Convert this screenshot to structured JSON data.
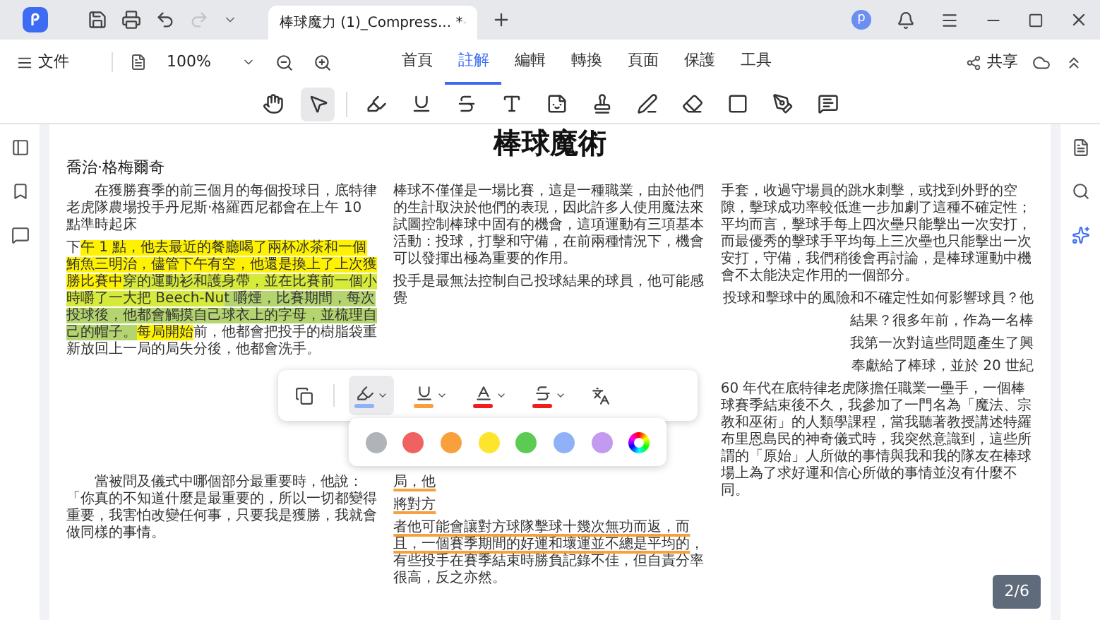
{
  "app": {
    "tab_title": "棒球魔力 (1)_Compress... *",
    "avatar": "p",
    "history": [
      {
        "kind": "undo",
        "disabled": false
      },
      {
        "kind": "redo",
        "disabled": true
      }
    ]
  },
  "menu": {
    "file": "文件",
    "zoom": "100%",
    "share": "共享",
    "tabs": [
      {
        "label": "首頁",
        "selected": false
      },
      {
        "label": "註解",
        "selected": true
      },
      {
        "label": "編輯",
        "selected": false
      },
      {
        "label": "轉換",
        "selected": false
      },
      {
        "label": "頁面",
        "selected": false
      },
      {
        "label": "保護",
        "selected": false
      },
      {
        "label": "工具",
        "selected": false
      }
    ]
  },
  "tools": [
    {
      "kind": "hand",
      "selected": false
    },
    {
      "kind": "select",
      "selected": true
    },
    {
      "kind": "highlight",
      "selected": false
    },
    {
      "kind": "underline",
      "selected": false
    },
    {
      "kind": "strikethrough",
      "selected": false
    },
    {
      "kind": "squiggly",
      "selected": false
    },
    {
      "kind": "shape",
      "selected": false
    },
    {
      "kind": "stamp",
      "selected": false
    },
    {
      "kind": "marker",
      "selected": false
    },
    {
      "kind": "eraser",
      "selected": false
    },
    {
      "kind": "rectangle",
      "selected": false
    },
    {
      "kind": "pen",
      "selected": false
    },
    {
      "kind": "comment",
      "selected": false
    }
  ],
  "document": {
    "title": "棒球魔術",
    "author": "喬治·格梅爾奇",
    "left_top": [
      {
        "kind": "paragraph",
        "indented": true,
        "segments": [
          {
            "kind": "plain",
            "text": "在獲勝賽季的前三個月的每個投球日，底特律老虎隊農場投手丹尼斯·格羅西尼都會在上午 10 點準時起床"
          }
        ]
      },
      {
        "kind": "paragraph",
        "indented": false,
        "segments": [
          {
            "kind": "plain",
            "text": "下"
          },
          {
            "kind": "highlight",
            "color": "#fff200",
            "text": "午 1 點，他去最近的餐廳喝了兩杯冰茶和一個鮪魚三明治，儘管下午有空，他還是換上了上次獲勝比賽中"
          },
          {
            "kind": "highlight",
            "color": "#d6ea3a",
            "text": "穿的運動衫和護身帶，並在比賽前一個小時嚼了一大把 Beech-Nu"
          },
          {
            "kind": "highlight",
            "color": "#b3d46e",
            "text": "t 嚼煙，比賽期間，每次投球後，他都會觸摸自己球衣上的字母，並梳理自己的帽子。"
          },
          {
            "kind": "highlight",
            "color": "#fff200",
            "text": "每局開始"
          },
          {
            "kind": "plain",
            "text": "前，他都會把投手的樹脂袋重新放回上一局的"
          },
          {
            "kind": "plain",
            "text": "局失分後，他都會洗手。"
          }
        ]
      }
    ],
    "middle_top": [
      {
        "kind": "paragraph",
        "indented": false,
        "segments": [
          {
            "kind": "plain",
            "text": "棒球不僅僅是一場比賽，這是一種職業，由於他們的生計取決於他們的表現，因此許多人使用魔法來試圖控制棒球中固有的機會，這項運動有三項基本活動：投球，打擊和守備，在前兩種情況下，機會可以發揮出極為重要的作用。"
          }
        ]
      },
      {
        "kind": "paragraph",
        "indented": false,
        "segments": [
          {
            "kind": "plain",
            "text": "投手是最無法控制自己投球結果的球員，他可能感覺"
          }
        ]
      }
    ],
    "right": [
      {
        "kind": "paragraph",
        "indented": false,
        "segments": [
          {
            "kind": "plain",
            "text": "手套，收過守場員的跳水刺擊，或找到外野的空隙，擊球成功率較低進一步加劇了這種不確定性；平均而言，擊球手每上四次壘只能擊出一次安打，而最優秀的擊球手平均每上三次壘也只能擊出一次安打，守備，我們稍後會再討論，是棒球運動中機會不太能決定作用的一個部分。"
          }
        ]
      },
      {
        "kind": "fragment",
        "segments": [
          {
            "kind": "plain",
            "text": "投球和擊球中的風險和不確定性如何影響球員？他"
          }
        ]
      },
      {
        "kind": "fragment",
        "segments": [
          {
            "kind": "plain",
            "text": "結果？很多年前，作為一名棒"
          }
        ]
      },
      {
        "kind": "fragment",
        "segments": [
          {
            "kind": "plain",
            "text": "我第一次對這些問題產生了興"
          }
        ]
      },
      {
        "kind": "fragment",
        "segments": [
          {
            "kind": "plain",
            "text": "奉獻給了棒球，並於 20 世紀"
          }
        ]
      },
      {
        "kind": "paragraph",
        "indented": false,
        "segments": [
          {
            "kind": "plain",
            "text": "60 年代在底特律老虎隊擔任職業一壘手，一個棒球賽季結束後不久，我參加了一門名為「魔法、宗教和巫術」的人類學課程，當我聽著教授講述特羅布里恩島民的神奇儀式時，我突然意識到，這些所謂的「原始」人所做的事情與我和我的隊友在棒球場上為了求好運和信心所做的事情並沒有什麼不同。"
          }
        ]
      }
    ],
    "left_bottom": [
      {
        "kind": "paragraph",
        "indented": true,
        "segments": [
          {
            "kind": "plain",
            "text": "當被問及儀式中哪個部分最重要時，他說：「你真的不知道什麼是最重要的，所以一切都變得重要，我害怕改變任何事，只要我是獲勝，我就會做同樣的事情。"
          }
        ]
      }
    ],
    "middle_bottom": [
      {
        "kind": "paragraph",
        "indented": false,
        "segments": [
          {
            "kind": "underline",
            "color": "#f7a03c",
            "text": "局，他"
          }
        ]
      },
      {
        "kind": "paragraph",
        "indented": false,
        "segments": [
          {
            "kind": "underline",
            "color": "#f7a03c",
            "text": "將對方"
          }
        ]
      },
      {
        "kind": "paragraph",
        "indented": false,
        "segments": [
          {
            "kind": "underline",
            "color": "#f7a03c",
            "text": "者他可能會讓對方球隊擊球十幾次無功而返，而且，一個賽季期間的好運和壞運並不總是平均的"
          },
          {
            "kind": "plain",
            "text": "，有些投手在賽季結束時勝負記錄不佳，但自責分率很高，反之亦然。"
          }
        ]
      }
    ]
  },
  "popup": {
    "tools": [
      {
        "kind": "copy",
        "selected": false
      },
      {
        "kind": "highlight",
        "selected": true,
        "color": "#8fb1f8"
      },
      {
        "kind": "underline",
        "selected": false,
        "color": "#f7a03c"
      },
      {
        "kind": "text-color",
        "selected": false,
        "color": "#f01d1d"
      },
      {
        "kind": "strikethrough",
        "selected": false,
        "color": "#f01d1d"
      },
      {
        "kind": "translate",
        "selected": false
      }
    ],
    "palette": [
      {
        "kind": "swatch",
        "color": "#b0b3b8"
      },
      {
        "kind": "swatch",
        "color": "#f06262"
      },
      {
        "kind": "swatch",
        "color": "#f7a03c"
      },
      {
        "kind": "swatch",
        "color": "#fde52c"
      },
      {
        "kind": "swatch",
        "color": "#5ccb54"
      },
      {
        "kind": "swatch",
        "color": "#8fb1f8"
      },
      {
        "kind": "swatch",
        "color": "#c29af0"
      },
      {
        "kind": "spectrum"
      }
    ]
  },
  "page_indicator": "2/6"
}
